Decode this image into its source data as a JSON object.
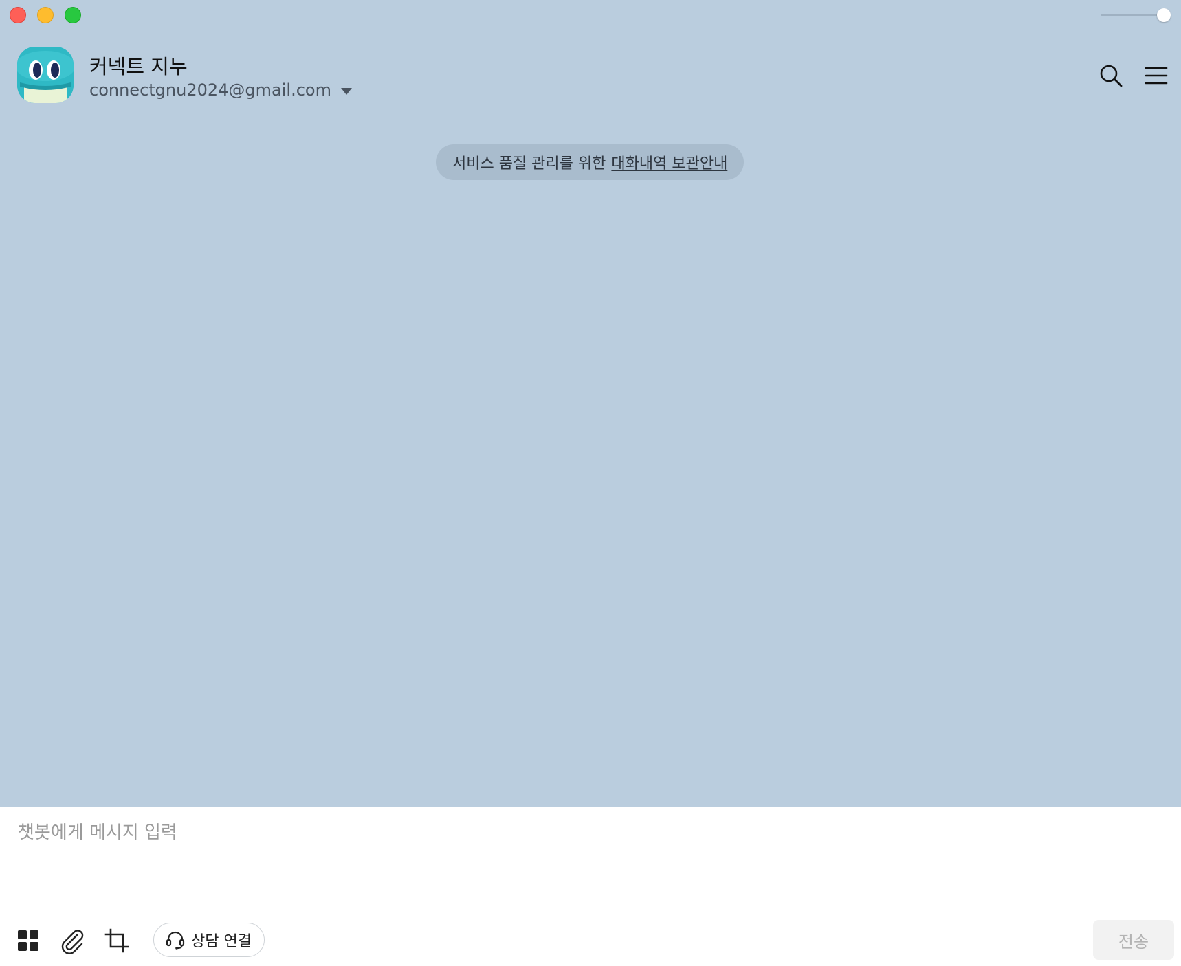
{
  "window": {
    "controls": [
      "close",
      "minimize",
      "zoom"
    ]
  },
  "header": {
    "bot_name": "커넥트 지누",
    "account": "connectgnu2024@gmail.com",
    "icons": [
      "search-icon",
      "hamburger-menu-icon"
    ]
  },
  "notice": {
    "text": "서비스 품질 관리를 위한",
    "link": "대화내역 보관안내"
  },
  "composer": {
    "placeholder": "챗봇에게 메시지 입력",
    "tools": [
      "apps-grid-icon",
      "paperclip-icon",
      "crop-icon"
    ],
    "counsel_label": "상담 연결",
    "counsel_icon": "headset-icon",
    "send_label": "전송"
  },
  "colors": {
    "chat_background": "#bacdde",
    "notice_pill": "#a9bccd",
    "composer_background": "#ffffff",
    "send_disabled_text": "#b3b3b3",
    "avatar": "#2fb9c5"
  }
}
